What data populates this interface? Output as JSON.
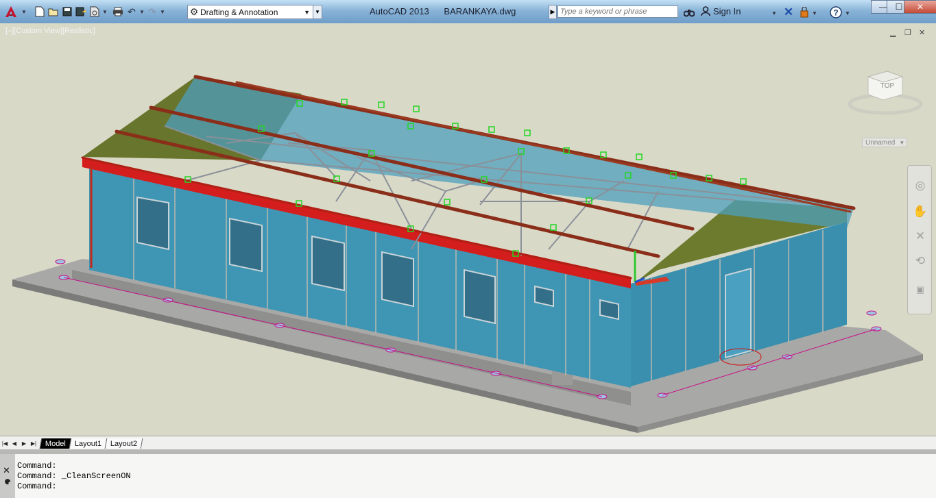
{
  "window": {
    "app_name": "AutoCAD 2013",
    "file_name": "BARANKAYA.dwg",
    "buttons": {
      "minimize": "—",
      "maximize": "☐",
      "close": "✕"
    }
  },
  "toolbar": {
    "workspace": "Drafting & Annotation",
    "search_placeholder": "Type a keyword or phrase",
    "sign_in": "Sign In",
    "help": "?"
  },
  "viewport": {
    "label": "[–][Custom View][Realistic]",
    "viewcube_face": "TOP",
    "named_view": "Unnamed",
    "controls": {
      "minimize": "▁",
      "restore": "❐",
      "close": "✕"
    }
  },
  "layout_tabs": [
    {
      "label": "Model",
      "active": true
    },
    {
      "label": "Layout1",
      "active": false
    },
    {
      "label": "Layout2",
      "active": false
    }
  ],
  "command_history": [
    "Command:",
    "Command: _CleanScreenON",
    "Command:"
  ],
  "icons": {
    "app_menu": "autocad-logo-icon",
    "qat": [
      "new-icon",
      "open-icon",
      "save-icon",
      "save-as-icon",
      "plot-preview-icon",
      "print-icon",
      "undo-icon",
      "redo-icon"
    ],
    "infocenter": [
      "binoculars-icon",
      "user-icon",
      "exchange-icon",
      "autodesk-360-icon",
      "help-icon"
    ],
    "navbar": [
      "steering-wheel-icon",
      "pan-icon",
      "zoom-icon",
      "orbit-icon",
      "showmotion-icon"
    ]
  },
  "colors": {
    "title_bar": "#8ab4d8",
    "viewport_bg": "#d9d9c8",
    "wall": "#3f95b4",
    "roof_panel": "#6d7b2e",
    "beam": "#cf2020",
    "purlin": "#8a2e1a",
    "steel": "#8a9098"
  }
}
